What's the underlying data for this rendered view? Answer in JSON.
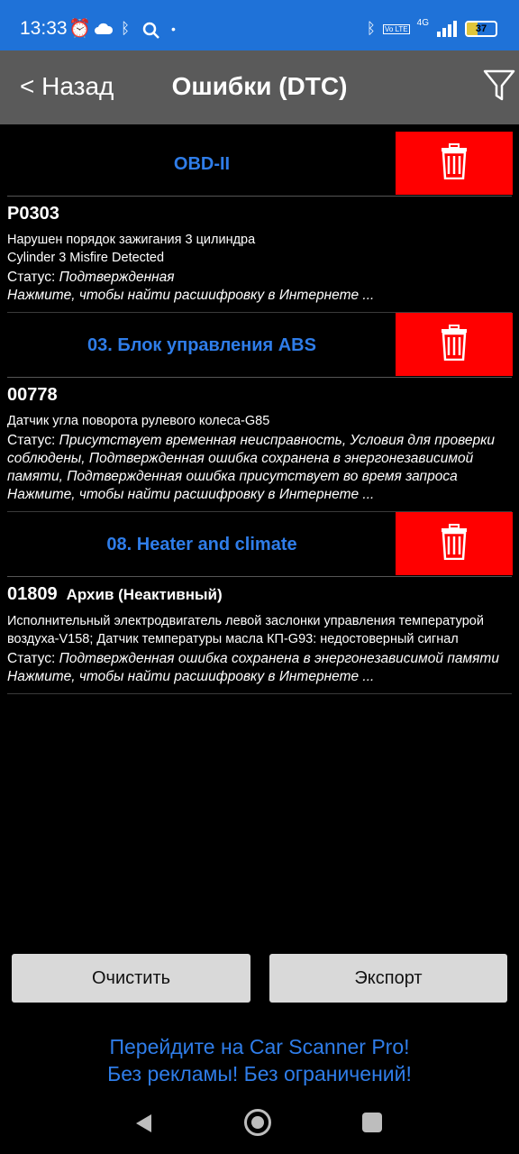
{
  "status_bar": {
    "time": "13:33",
    "network": "4G",
    "volte": "Vo LTE",
    "battery": "37",
    "battery_level_percent": 37,
    "left_icons": [
      "alarm-icon",
      "cloud-icon",
      "bluetooth-icon",
      "search-icon",
      "dot-icon"
    ],
    "right_icons": [
      "bluetooth-icon",
      "volte-icon",
      "signal-icon",
      "battery-icon"
    ]
  },
  "app_bar": {
    "back_label": "< Назад",
    "title": "Ошибки (DTC)",
    "filter_icon": "filter-icon"
  },
  "modules": [
    {
      "name": "OBD-II",
      "delete_icon": "trash-icon",
      "errors": [
        {
          "code": "P0303",
          "archive": "",
          "description": [
            "Нарушен порядок зажигания 3 цилиндра",
            "Cylinder 3 Misfire Detected"
          ],
          "status_label": "Статус: ",
          "status_value": "Подтвержденная",
          "hint": "Нажмите, чтобы найти расшифровку в Интернете ..."
        }
      ]
    },
    {
      "name": "03. Блок управления ABS",
      "delete_icon": "trash-icon",
      "errors": [
        {
          "code": "00778",
          "archive": "",
          "description": [
            "Датчик угла поворота рулевого колеса-G85"
          ],
          "status_label": "Статус: ",
          "status_value": "Присутствует временная неисправность, Условия для проверки соблюдены, Подтвержденная ошибка сохранена в энергонезависимой памяти, Подтвержденная ошибка присутствует во время запроса",
          "hint": "Нажмите, чтобы найти расшифровку в Интернете ..."
        }
      ]
    },
    {
      "name": "08. Heater and climate",
      "delete_icon": "trash-icon",
      "errors": [
        {
          "code": "01809",
          "archive": "Архив (Неактивный)",
          "description": [
            "Исполнительный электродвигатель левой заслонки управления температурой воздуха-V158; Датчик температуры масла КП-G93: недостоверный сигнал"
          ],
          "status_label": "Статус: ",
          "status_value": "Подтвержденная ошибка сохранена в энергонезависимой памяти",
          "hint": "Нажмите, чтобы найти расшифровку в Интернете ..."
        }
      ]
    }
  ],
  "buttons": {
    "clear": "Очистить",
    "export": "Экспорт"
  },
  "promo": {
    "line1": "Перейдите на Car Scanner Pro!",
    "line2": "Без рекламы! Без ограничений!"
  },
  "colors": {
    "status_bar": "#1f72d8",
    "app_bar": "#5a5a5a",
    "accent": "#2f7de9",
    "delete": "#ff0000",
    "background": "#000000",
    "button": "#d9d9d9"
  }
}
